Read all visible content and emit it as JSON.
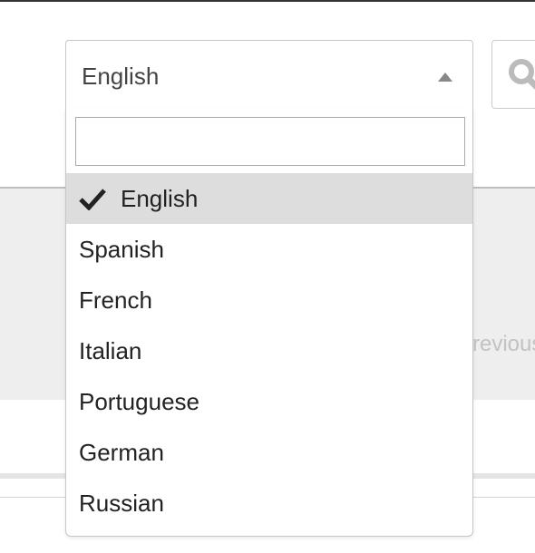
{
  "language_select": {
    "selected_value": "English",
    "search_value": "",
    "options": [
      {
        "label": "English",
        "selected": true
      },
      {
        "label": "Spanish",
        "selected": false
      },
      {
        "label": "French",
        "selected": false
      },
      {
        "label": "Italian",
        "selected": false
      },
      {
        "label": "Portuguese",
        "selected": false
      },
      {
        "label": "German",
        "selected": false
      },
      {
        "label": "Russian",
        "selected": false
      }
    ]
  },
  "pagination": {
    "previous_label": "Previous"
  },
  "icons": {
    "search": "search-icon",
    "caret": "caret-up-icon",
    "check": "check-icon"
  },
  "colors": {
    "selected_option_bg": "#dddddd",
    "panel_bg": "#eeeeee",
    "muted_text": "#c2c2c2"
  }
}
